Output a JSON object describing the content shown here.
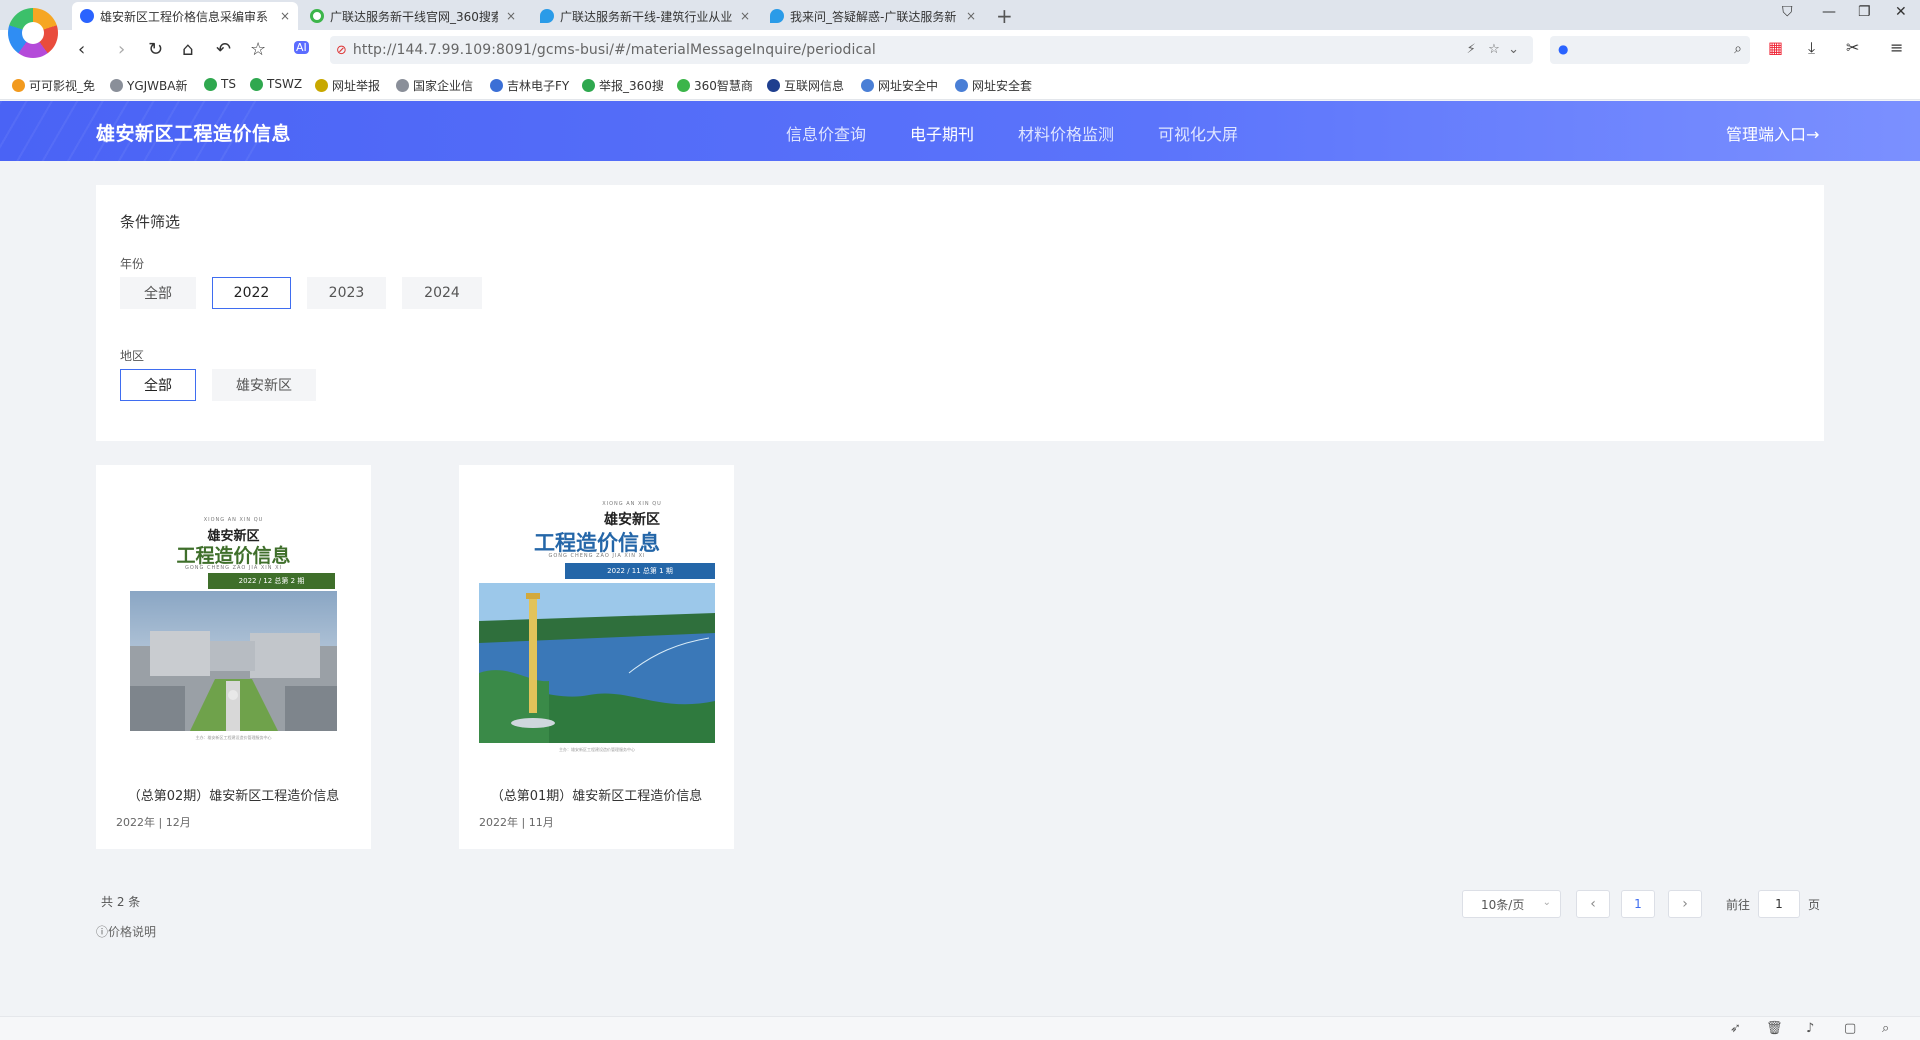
{
  "browser": {
    "tabs": [
      {
        "title": "雄安新区工程价格信息采编审系",
        "close": "×"
      },
      {
        "title": "广联达服务新干线官网_360搜索",
        "close": "×"
      },
      {
        "title": "广联达服务新干线-建筑行业从业",
        "close": "×"
      },
      {
        "title": "我来问_答疑解惑-广联达服务新",
        "close": "×"
      }
    ],
    "new_tab": "+",
    "url": "http://144.7.99.109:8091/gcms-busi/#/materialMessageInquire/periodical",
    "bookmarks": [
      {
        "label": "可可影视_免",
        "color": "#f29a1e"
      },
      {
        "label": "YGJWBA新",
        "color": "#8a8f99"
      },
      {
        "label": "TS",
        "color": "#2fa84f"
      },
      {
        "label": "TSWZ",
        "color": "#2fa84f"
      },
      {
        "label": "网址举报",
        "color": "#c8a800"
      },
      {
        "label": "国家企业信",
        "color": "#8a8f99"
      },
      {
        "label": "吉林电子FY",
        "color": "#3b6fd6"
      },
      {
        "label": "举报_360搜",
        "color": "#2fa84f"
      },
      {
        "label": "360智慧商",
        "color": "#3cb54a"
      },
      {
        "label": "互联网信息",
        "color": "#1f3f8f"
      },
      {
        "label": "网址安全中",
        "color": "#4a7fd6"
      },
      {
        "label": "网址安全套",
        "color": "#4a7fd6"
      }
    ]
  },
  "site": {
    "logo": "雄安新区工程造价信息",
    "nav": [
      "信息价查询",
      "电子期刊",
      "材料价格监测",
      "可视化大屏"
    ],
    "admin_link": "管理端入口→"
  },
  "filter": {
    "title": "条件筛选",
    "year_label": "年份",
    "years": [
      "全部",
      "2022",
      "2023",
      "2024"
    ],
    "selected_year": "2022",
    "region_label": "地区",
    "regions": [
      "全部",
      "雄安新区"
    ],
    "selected_region": "全部"
  },
  "journals": [
    {
      "title": "（总第02期）雄安新区工程造价信息",
      "date": "2022年 | 12月",
      "cover": {
        "pinyin": "XIONG AN XIN QU",
        "region": "雄安新区",
        "name": "工程造价信息",
        "name_pinyin": "GONG CHENG ZAO JIA XIN XI",
        "issue": "2022 / 12      总第 2 期",
        "footer": "主办：雄安新区工程建设造价管理服务中心",
        "accent": "#3f6f2b"
      }
    },
    {
      "title": "（总第01期）雄安新区工程造价信息",
      "date": "2022年 | 11月",
      "cover": {
        "pinyin": "XIONG AN XIN QU",
        "region": "雄安新区",
        "name": "工程造价信息",
        "name_pinyin": "GONG CHENG ZAO JIA XIN XI",
        "issue": "2022 / 11      总第 1 期",
        "footer": "主办：雄安新区工程建设造价管理服务中心",
        "accent": "#2466a8"
      }
    }
  ],
  "pagination": {
    "total": "共 2 条",
    "price_note": "ⓘ价格说明",
    "page_size": "10条/页",
    "prev": "‹",
    "current": "1",
    "next": "›",
    "goto_prefix": "前往",
    "goto_value": "1",
    "goto_suffix": "页"
  }
}
